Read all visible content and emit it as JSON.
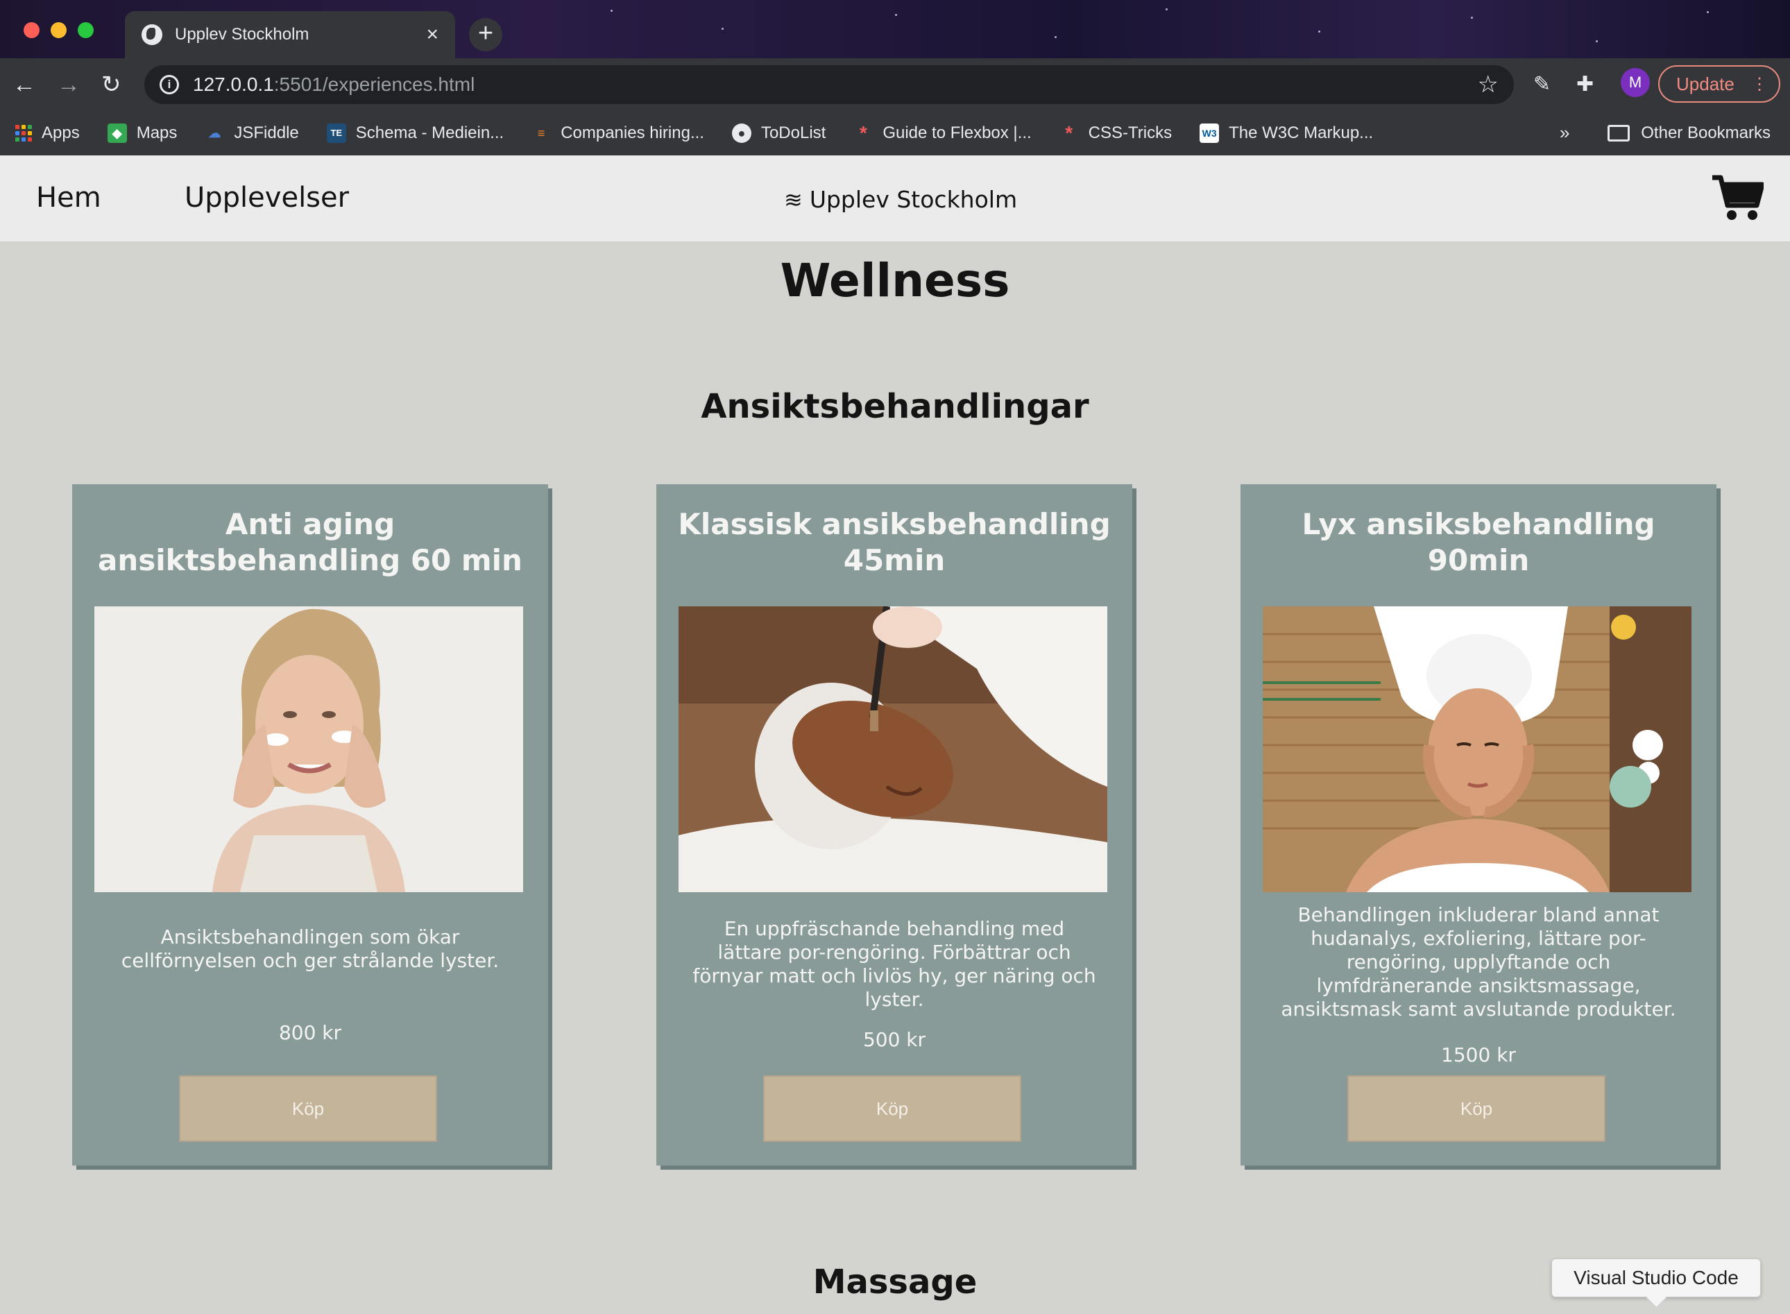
{
  "browser": {
    "tab_title": "Upplev Stockholm",
    "tab_close": "×",
    "new_tab": "+",
    "url_host": "127.0.0.1",
    "url_path": ":5501/experiences.html",
    "update_label": "Update",
    "avatar_initial": "M",
    "bookmarks": [
      {
        "label": "Apps",
        "icon": "apps-grid-icon"
      },
      {
        "label": "Maps",
        "icon": "maps-icon"
      },
      {
        "label": "JSFiddle",
        "icon": "jsfiddle-icon"
      },
      {
        "label": "Schema - Mediein...",
        "icon": "te-icon"
      },
      {
        "label": "Companies hiring...",
        "icon": "stackoverflow-icon"
      },
      {
        "label": "ToDoList",
        "icon": "globe-icon"
      },
      {
        "label": "Guide to Flexbox |...",
        "icon": "csstricks-icon"
      },
      {
        "label": "CSS-Tricks",
        "icon": "csstricks-icon"
      },
      {
        "label": "The W3C Markup...",
        "icon": "w3c-icon"
      }
    ],
    "more_bookmarks": "»",
    "other_bookmarks": "Other Bookmarks"
  },
  "site": {
    "nav": {
      "home": "Hem",
      "experiences": "Upplevelser"
    },
    "brand": "Upplev Stockholm",
    "page_title": "Wellness",
    "sections": [
      {
        "title": "Ansiktsbehandlingar",
        "cards": [
          {
            "title": "Anti aging ansiktsbehandling 60 min",
            "description": "Ansiktsbehandlingen som ökar cellförnyelsen och ger strålande lyster.",
            "price": "800 kr",
            "button": "Köp",
            "image": "older-woman-applying-cream-photo"
          },
          {
            "title": "Klassisk ansiksbehandling 45min",
            "description": "En uppfräschande behandling med lättare por-rengöring. Förbättrar och förnyar matt och livlös hy, ger näring och lyster.",
            "price": "500 kr",
            "button": "Köp",
            "image": "clay-face-mask-photo"
          },
          {
            "title": "Lyx ansiksbehandling 90min",
            "description": "Behandlingen inkluderar bland annat hudanalys, exfoliering, lättare por-rengöring, upplyftande och lymfdränerande ansiktsmassage, ansiktsmask samt avslutande produkter.",
            "price": "1500 kr",
            "button": "Köp",
            "image": "spa-face-massage-photo"
          }
        ]
      },
      {
        "title": "Massage"
      }
    ]
  },
  "tooltip": "Visual Studio Code"
}
